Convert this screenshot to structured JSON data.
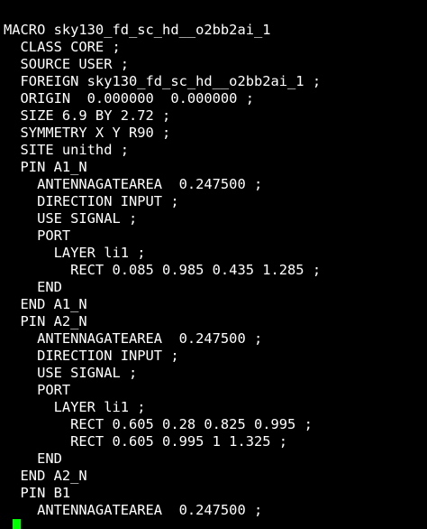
{
  "terminal": {
    "lines": [
      "MACRO sky130_fd_sc_hd__o2bb2ai_1",
      "  CLASS CORE ;",
      "  SOURCE USER ;",
      "  FOREIGN sky130_fd_sc_hd__o2bb2ai_1 ;",
      "  ORIGIN  0.000000  0.000000 ;",
      "  SIZE 6.9 BY 2.72 ;",
      "  SYMMETRY X Y R90 ;",
      "  SITE unithd ;",
      "  PIN A1_N",
      "    ANTENNAGATEAREA  0.247500 ;",
      "    DIRECTION INPUT ;",
      "    USE SIGNAL ;",
      "    PORT",
      "      LAYER li1 ;",
      "        RECT 0.085 0.985 0.435 1.285 ;",
      "    END",
      "  END A1_N",
      "  PIN A2_N",
      "    ANTENNAGATEAREA  0.247500 ;",
      "    DIRECTION INPUT ;",
      "    USE SIGNAL ;",
      "    PORT",
      "      LAYER li1 ;",
      "        RECT 0.605 0.28 0.825 0.995 ;",
      "        RECT 0.605 0.995 1 1.325 ;",
      "    END",
      "  END A2_N",
      "  PIN B1",
      "    ANTENNAGATEAREA  0.247500 ;"
    ],
    "prompt": ".",
    "colors": {
      "background": "#000000",
      "text": "#ffffff",
      "cursor": "#00ff00"
    }
  }
}
